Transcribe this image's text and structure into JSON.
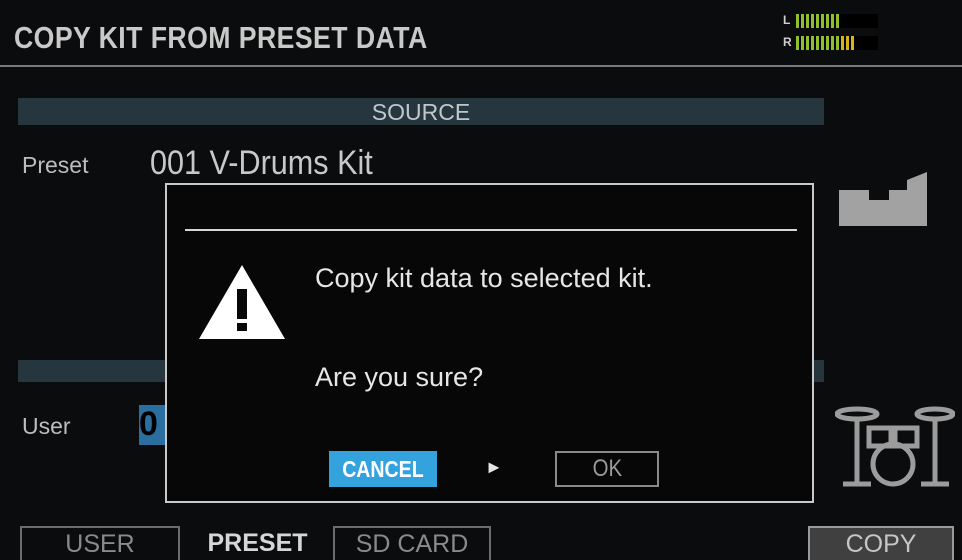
{
  "header": {
    "title": "COPY KIT FROM PRESET DATA"
  },
  "meters": {
    "left_label": "L",
    "right_label": "R",
    "left_level": 0.55,
    "right_level": 0.72
  },
  "source": {
    "section_label": "SOURCE",
    "type_label": "Preset",
    "kit_name": "001 V-Drums Kit"
  },
  "destination": {
    "type_label": "User",
    "kit_number_visible": "0"
  },
  "dialog": {
    "message": "Copy kit data to selected kit.",
    "question": "Are you sure?",
    "cancel_label": "CANCEL",
    "ok_label": "OK",
    "cursor_symbol": "►",
    "selected": "CANCEL"
  },
  "tabs": [
    {
      "label": "USER",
      "active": false
    },
    {
      "label": "PRESET",
      "active": true
    },
    {
      "label": "SD CARD",
      "active": false
    }
  ],
  "function_button": {
    "label": "COPY"
  },
  "colors": {
    "accent": "#34a3dd",
    "section_bar": "#26363e",
    "meter_green": "#8fbf2a",
    "meter_yellow": "#d8b21a"
  },
  "icons": {
    "warning": "warning-icon",
    "flow": "copy-flow-icon",
    "drum": "drum-kit-icon"
  }
}
